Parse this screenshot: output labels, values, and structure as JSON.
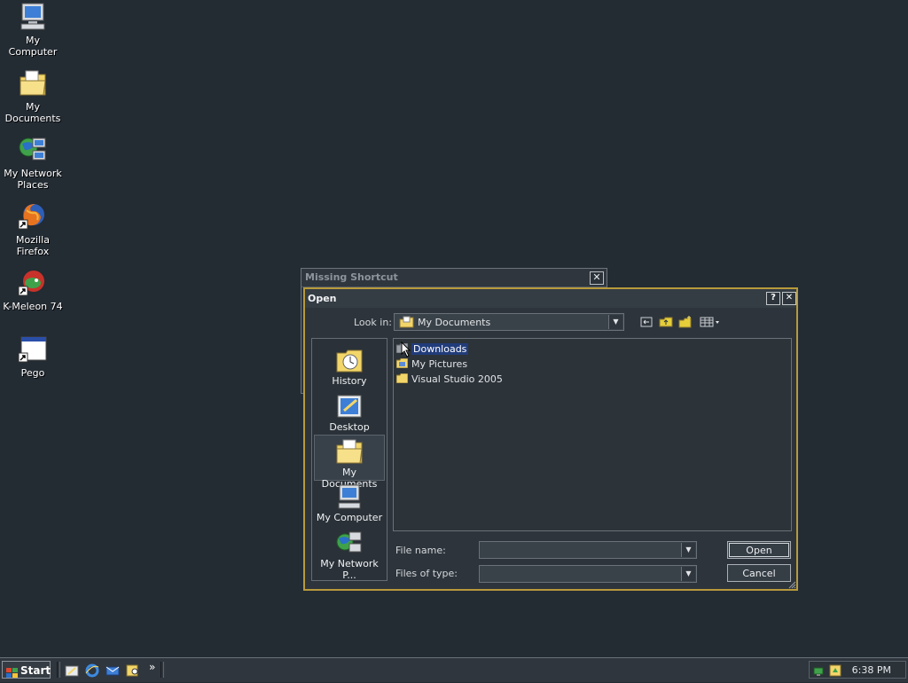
{
  "desktop": {
    "icons": [
      {
        "label": "My Computer",
        "icon": "computer-icon"
      },
      {
        "label": "My Documents",
        "icon": "documents-folder-icon"
      },
      {
        "label_line1": "My Network",
        "label_line2": "Places",
        "icon": "network-places-icon"
      },
      {
        "label": "Mozilla Firefox",
        "icon": "firefox-icon"
      },
      {
        "label": "K-Meleon 74",
        "icon": "kmeleon-icon"
      },
      {
        "label": "Pego",
        "icon": "app-window-icon"
      }
    ]
  },
  "back_window": {
    "title": "Missing Shortcut",
    "close": "✕"
  },
  "dialog": {
    "title": "Open",
    "help": "?",
    "close": "✕",
    "look_in_label": "Look in:",
    "look_in_value": "My Documents",
    "places": [
      {
        "label": "History",
        "icon": "history-icon"
      },
      {
        "label": "Desktop",
        "icon": "desktop-icon"
      },
      {
        "label": "My Documents",
        "icon": "documents-folder-icon"
      },
      {
        "label": "My Computer",
        "icon": "computer-icon"
      },
      {
        "label": "My Network P...",
        "icon": "network-places-icon"
      }
    ],
    "files": [
      {
        "name": "Downloads",
        "selected": true
      },
      {
        "name": "My Pictures",
        "selected": false
      },
      {
        "name": "Visual Studio 2005",
        "selected": false
      }
    ],
    "file_name_label": "File name:",
    "file_name_value": "",
    "files_of_type_label": "Files of type:",
    "files_of_type_value": "",
    "open_button": "Open",
    "cancel_button": "Cancel"
  },
  "taskbar": {
    "start_label": "Start",
    "chevron": "»",
    "clock": "6:38 PM"
  },
  "colors": {
    "desktop": "#232b33",
    "dialog_border": "#b89a3b",
    "selection": "#213c7a"
  }
}
